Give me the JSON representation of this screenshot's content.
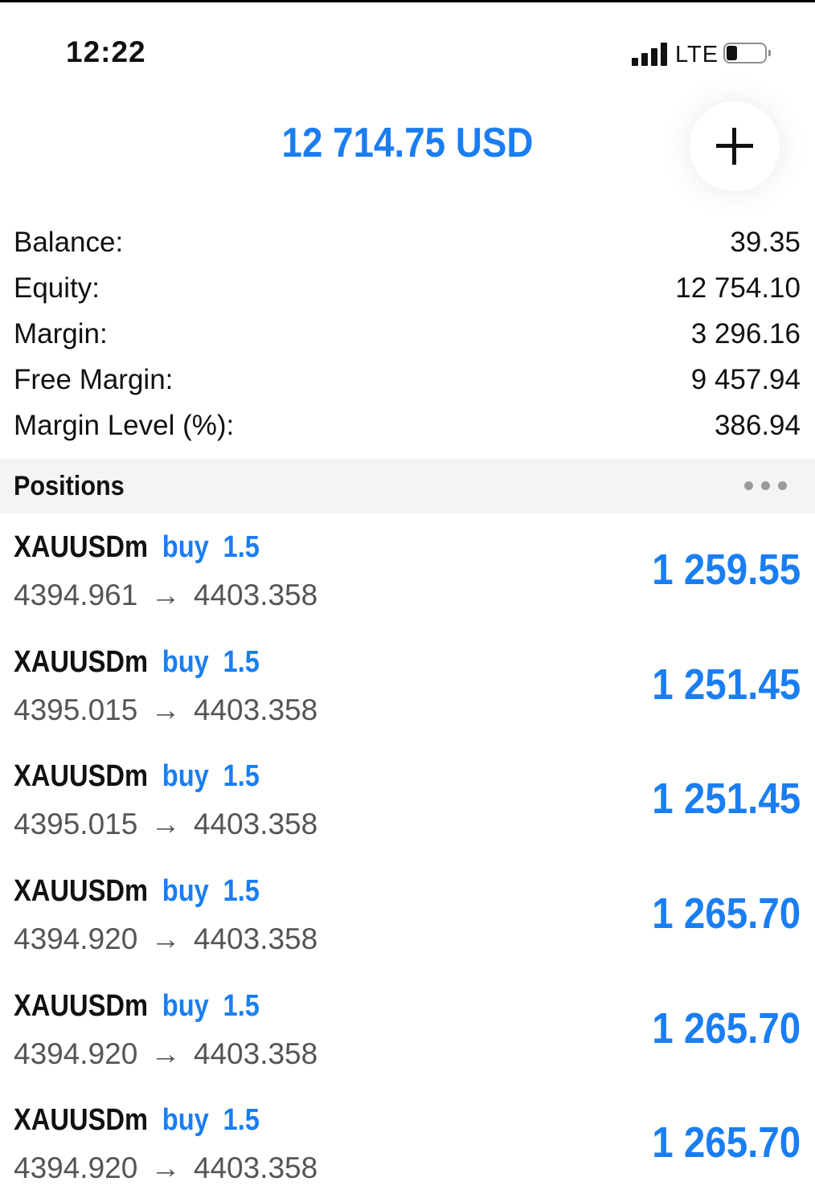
{
  "status_bar": {
    "time": "12:22",
    "network": "LTE",
    "icons": [
      "signal-icon",
      "battery-icon"
    ]
  },
  "header": {
    "total": "12 714.75 USD",
    "add_icon": "plus-icon"
  },
  "summary": [
    {
      "label": "Balance:",
      "value": "39.35"
    },
    {
      "label": "Equity:",
      "value": "12 754.10"
    },
    {
      "label": "Margin:",
      "value": "3 296.16"
    },
    {
      "label": "Free Margin:",
      "value": "9 457.94"
    },
    {
      "label": "Margin Level (%):",
      "value": "386.94"
    }
  ],
  "positions": {
    "title": "Positions",
    "more_icon": "more-dots-icon",
    "items": [
      {
        "symbol": "XAUUSDm",
        "side": "buy",
        "volume": "1.5",
        "open_price": "4394.961",
        "arrow": "→",
        "current_price": "4403.358",
        "profit": "1 259.55"
      },
      {
        "symbol": "XAUUSDm",
        "side": "buy",
        "volume": "1.5",
        "open_price": "4395.015",
        "arrow": "→",
        "current_price": "4403.358",
        "profit": "1 251.45"
      },
      {
        "symbol": "XAUUSDm",
        "side": "buy",
        "volume": "1.5",
        "open_price": "4395.015",
        "arrow": "→",
        "current_price": "4403.358",
        "profit": "1 251.45"
      },
      {
        "symbol": "XAUUSDm",
        "side": "buy",
        "volume": "1.5",
        "open_price": "4394.920",
        "arrow": "→",
        "current_price": "4403.358",
        "profit": "1 265.70"
      },
      {
        "symbol": "XAUUSDm",
        "side": "buy",
        "volume": "1.5",
        "open_price": "4394.920",
        "arrow": "→",
        "current_price": "4403.358",
        "profit": "1 265.70"
      },
      {
        "symbol": "XAUUSDm",
        "side": "buy",
        "volume": "1.5",
        "open_price": "4394.920",
        "arrow": "→",
        "current_price": "4403.358",
        "profit": "1 265.70"
      }
    ]
  },
  "colors": {
    "accent": "#1a7ef2",
    "text": "#111111",
    "secondary_text": "#555555",
    "section_bg": "#f4f4f4"
  }
}
